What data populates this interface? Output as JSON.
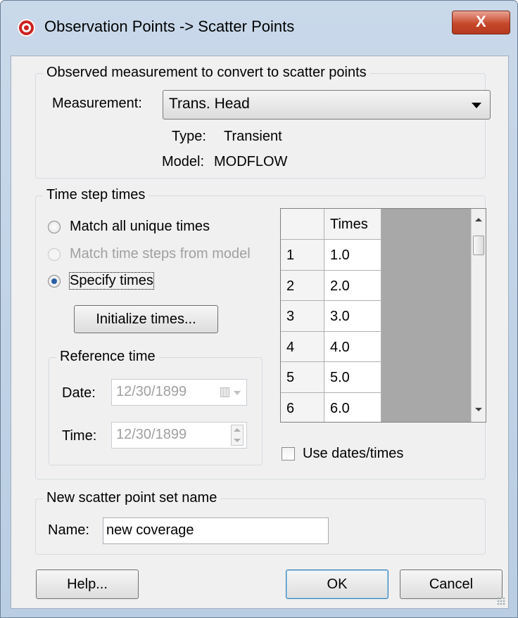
{
  "window": {
    "title": "Observation Points -> Scatter Points",
    "close_label": "X"
  },
  "measurement_group": {
    "title": "Observed measurement to convert to scatter points",
    "measurement_label": "Measurement:",
    "measurement_value": "Trans. Head",
    "type_label": "Type:",
    "type_value": "Transient",
    "model_label": "Model:",
    "model_value": "MODFLOW"
  },
  "time_group": {
    "title": "Time step times",
    "radio_match_all": "Match all unique times",
    "radio_match_model": "Match time steps from model",
    "radio_specify": "Specify times",
    "selected": "Specify times",
    "initialize_button": "Initialize times...",
    "reference": {
      "title": "Reference time",
      "date_label": "Date:",
      "date_value": "12/30/1899",
      "time_label": "Time:",
      "time_value": "12/30/1899"
    },
    "table": {
      "header": "Times",
      "rows": [
        {
          "n": "1",
          "time": "1.0"
        },
        {
          "n": "2",
          "time": "2.0"
        },
        {
          "n": "3",
          "time": "3.0"
        },
        {
          "n": "4",
          "time": "4.0"
        },
        {
          "n": "5",
          "time": "5.0"
        },
        {
          "n": "6",
          "time": "6.0"
        }
      ]
    },
    "use_dates_label": "Use dates/times",
    "use_dates_checked": false
  },
  "name_group": {
    "title": "New scatter point set name",
    "name_label": "Name:",
    "name_value": "new coverage"
  },
  "buttons": {
    "help": "Help...",
    "ok": "OK",
    "cancel": "Cancel"
  },
  "icons": {
    "app": "app-logo-icon",
    "close": "close-icon",
    "dropdown": "chevron-down-icon",
    "calendar": "calendar-icon",
    "spinner": "spinner-icon"
  },
  "colors": {
    "titlebar": "#c9d9ea",
    "close_button": "#c7482b",
    "client_bg": "#f0f0f0",
    "radio_dot": "#2a5fa5",
    "grid_empty": "#a8a8a8"
  }
}
